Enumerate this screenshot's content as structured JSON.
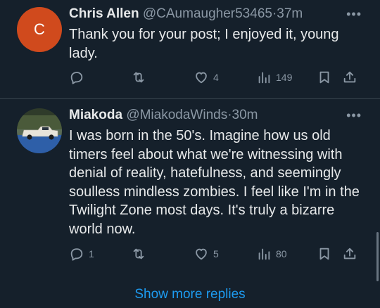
{
  "replies": [
    {
      "avatar_letter": "C",
      "avatar_color": "#d04a1d",
      "name": "Chris Allen",
      "handle": "@CAumaugher53465",
      "separator": "·",
      "time": "37m",
      "more_icon": "•••",
      "text": "Thank you for your post; I enjoyed it, young lady.",
      "actions": {
        "reply_count": "",
        "retweet_count": "",
        "like_count": "4",
        "views_count": "149"
      }
    },
    {
      "avatar_letter": "",
      "name": "Miakoda",
      "handle": "@MiakodaWinds",
      "separator": "·",
      "time": "30m",
      "more_icon": "•••",
      "text": "I was born in the 50's. Imagine how us old timers feel about what we're witnessing with denial of reality, hatefulness, and seemingly soulless mindless zombies. I feel like I'm in the Twilight Zone most days. It's truly a bizarre world now.",
      "actions": {
        "reply_count": "1",
        "retweet_count": "",
        "like_count": "5",
        "views_count": "80"
      }
    }
  ],
  "show_more_label": "Show more replies",
  "colors": {
    "background": "#15202b",
    "text": "#e7e9ea",
    "secondary": "#8b98a5",
    "accent": "#1d9bf0"
  }
}
